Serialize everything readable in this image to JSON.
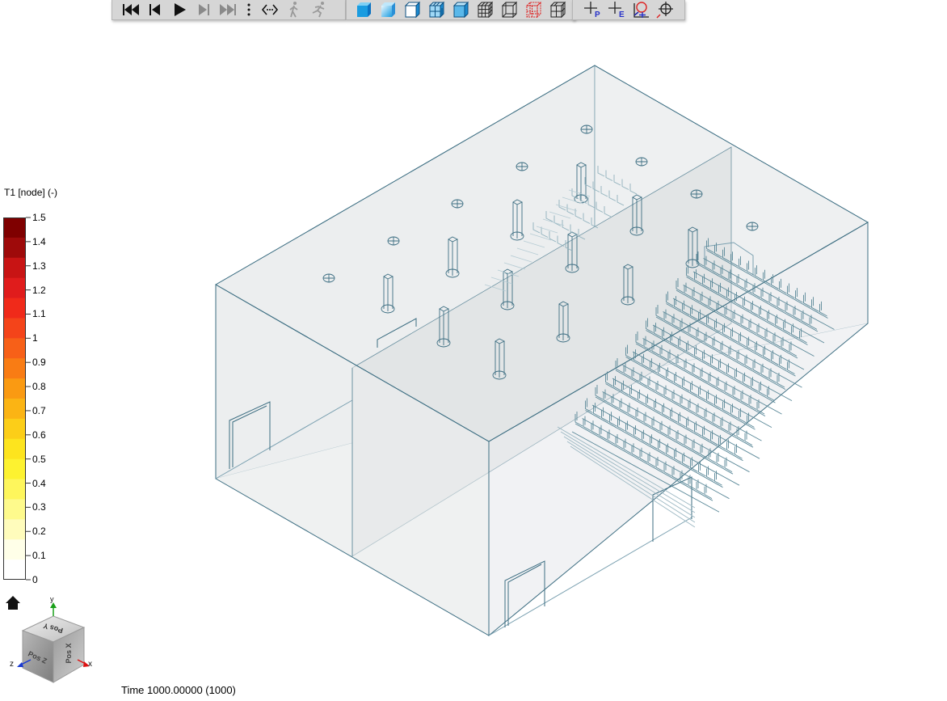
{
  "toolbar": {
    "playback": [
      "skip-to-start-icon",
      "step-back-icon",
      "play-icon",
      "step-forward-icon",
      "skip-to-end-icon",
      "more-options-icon",
      "loop-icon",
      "walk-icon",
      "run-icon"
    ],
    "view": [
      "solid-shaded-icon",
      "smooth-shaded-icon",
      "solid-outline-icon",
      "solid-edges-icon",
      "hidden-line-icon",
      "wireframe-mesh-icon",
      "wireframe-icon",
      "red-wireframe-icon",
      "hidden-wireframe-icon"
    ],
    "pick": [
      "pick-point-icon",
      "pick-element-icon",
      "measure-icon",
      "center-target-icon"
    ],
    "pick_letters": [
      "P",
      "E"
    ]
  },
  "legend": {
    "title": "T1 [node] (-)",
    "labels": [
      "1.5",
      "1.4",
      "1.3",
      "1.2",
      "1.1",
      "1",
      "0.9",
      "0.8",
      "0.7",
      "0.6",
      "0.5",
      "0.4",
      "0.3",
      "0.2",
      "0.1",
      "0"
    ],
    "colors": [
      "#7f0000",
      "#9e0a0a",
      "#c81414",
      "#e01c1c",
      "#f02a1a",
      "#f4441a",
      "#f76018",
      "#f97c14",
      "#fa9a12",
      "#fbb414",
      "#fcce18",
      "#fde41e",
      "#fdf230",
      "#fef65c",
      "#fefa8c",
      "#fffcbc",
      "#ffffe8",
      "#ffffff"
    ]
  },
  "status": {
    "time": "Time 1000.00000 (1000)"
  },
  "axes": {
    "x": "x",
    "y": "y",
    "z": "z"
  },
  "cube_faces": {
    "top": "Pos Y",
    "left": "Pos Z",
    "right": "Pos X"
  },
  "colors": {
    "edge": "#3d6e82",
    "wall": "#e9eced",
    "wall_dark": "#dcdfe0",
    "toolbar": "#d6d6d6"
  }
}
